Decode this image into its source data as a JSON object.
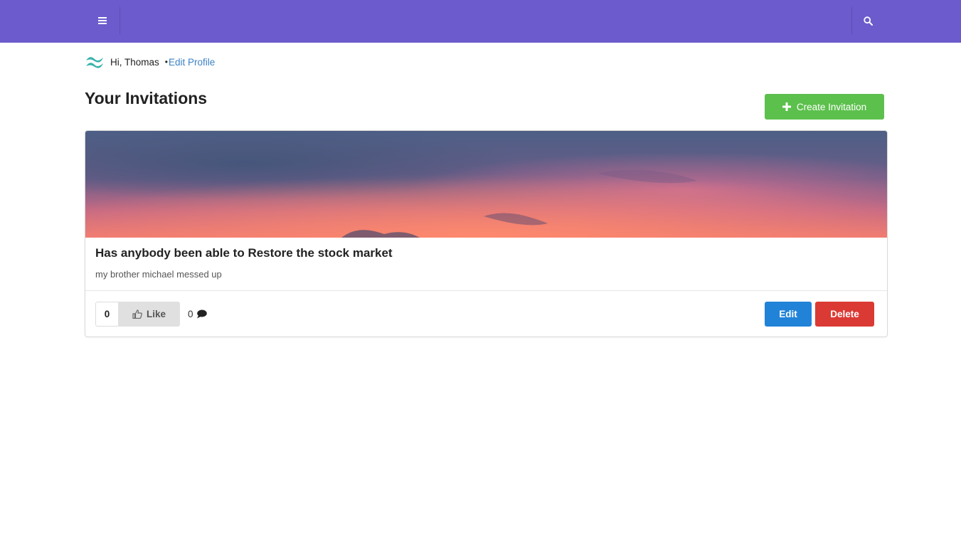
{
  "header": {
    "menu_icon": "hamburger-icon",
    "search_icon": "search-icon",
    "bg_color": "#6b5bcc"
  },
  "user": {
    "greeting": "Hi, Thomas",
    "separator": "•",
    "edit_profile_label": "Edit Profile"
  },
  "page": {
    "title": "Your Invitations",
    "create_button_label": "Create Invitation"
  },
  "invitation": {
    "title": "Has anybody been able to Restore the stock market",
    "description": "my brother michael messed up",
    "like_count": "0",
    "like_label": "Like",
    "comment_count": "0",
    "edit_label": "Edit",
    "delete_label": "Delete"
  },
  "colors": {
    "create": "#5cc04c",
    "edit": "#2183d8",
    "delete": "#db3a34",
    "link": "#3d82c4"
  }
}
